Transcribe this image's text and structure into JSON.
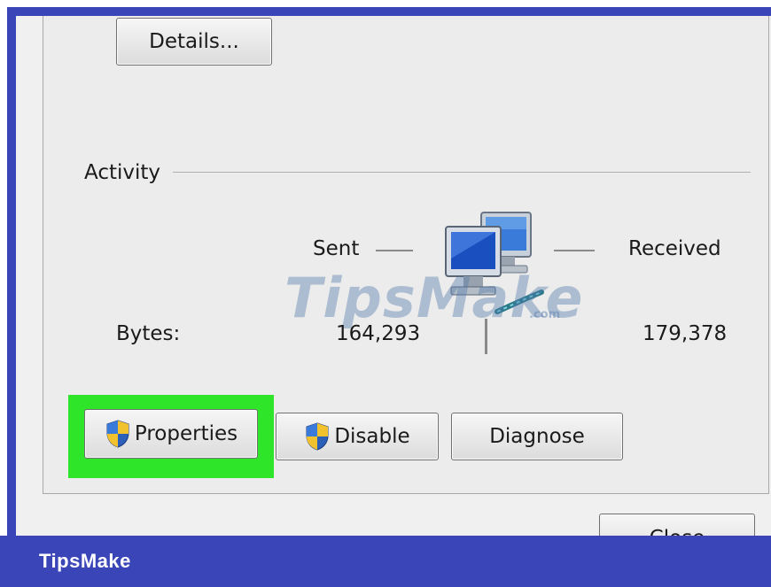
{
  "buttons": {
    "details": "Details...",
    "properties": "Properties",
    "disable": "Disable",
    "diagnose": "Diagnose",
    "close": "Close"
  },
  "activity": {
    "section_label": "Activity",
    "sent_label": "Sent",
    "received_label": "Received",
    "bytes_label": "Bytes:",
    "bytes_sent": "164,293",
    "bytes_received": "179,378"
  },
  "icons": {
    "network": "network-computers-icon",
    "shield": "uac-shield-icon"
  },
  "watermark": {
    "text": "TipsMake",
    "suffix": ".com"
  },
  "brand": {
    "name": "TipsMake"
  },
  "colors": {
    "highlight": "#2fe52a",
    "brand_bar": "#3a46b8",
    "dialog_bg": "#ececec"
  }
}
